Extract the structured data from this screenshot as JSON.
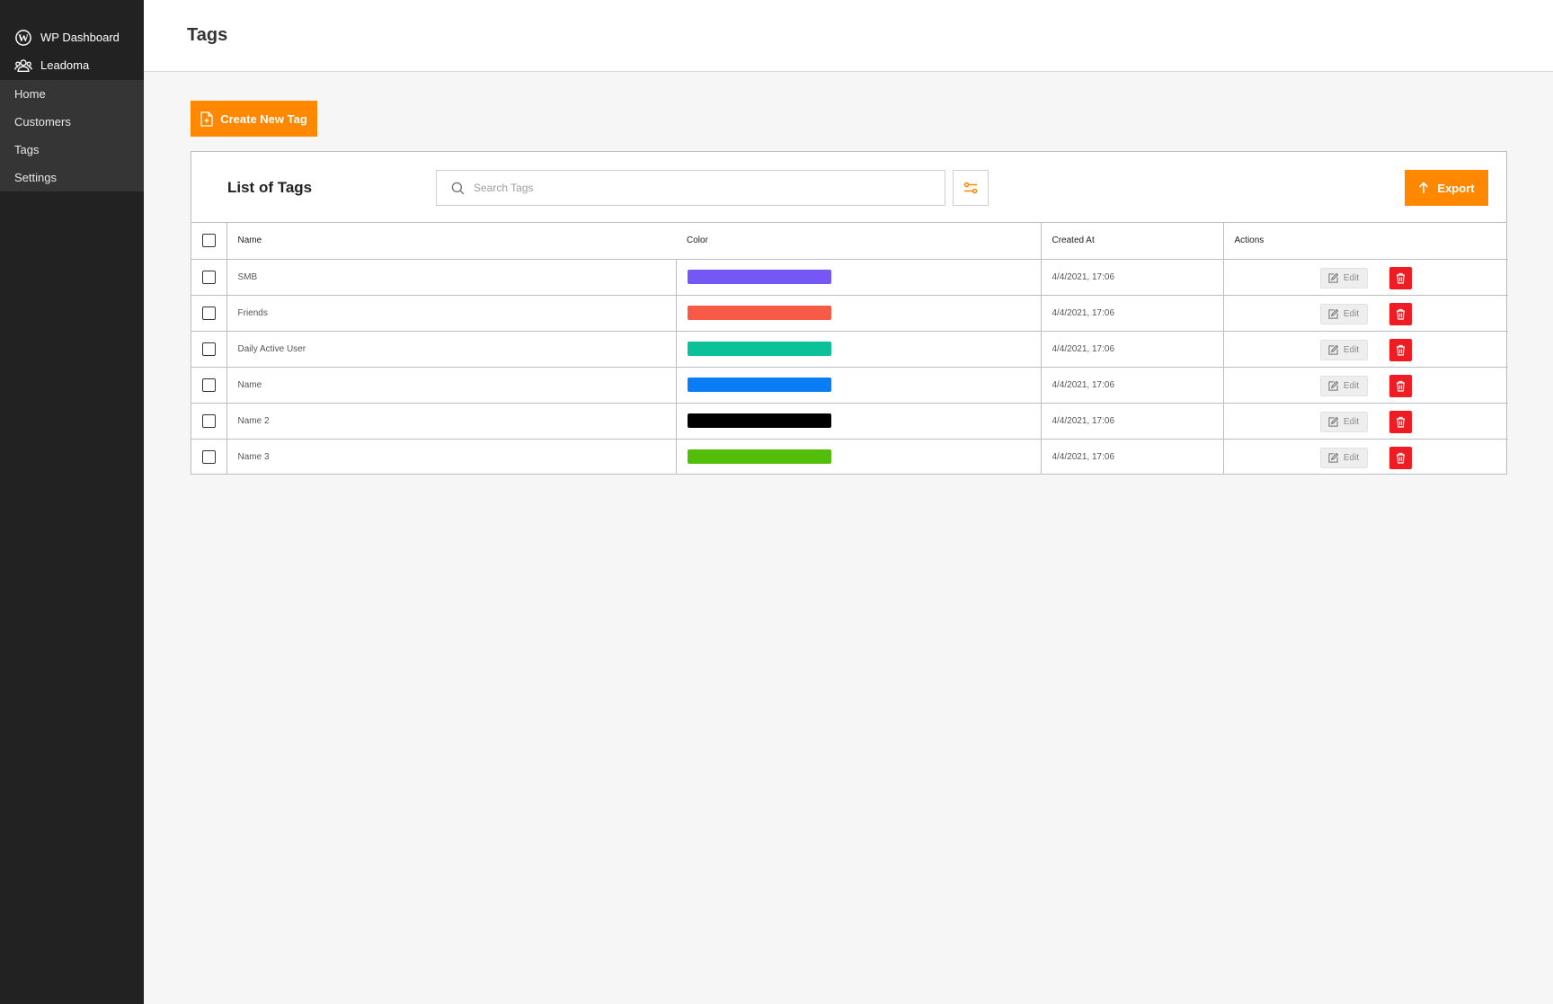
{
  "sidebar": {
    "brand_items": [
      {
        "label": "WP Dashboard",
        "icon": "wordpress-icon"
      },
      {
        "label": "Leadoma",
        "icon": "users-icon"
      }
    ],
    "nav_items": [
      {
        "label": "Home"
      },
      {
        "label": "Customers"
      },
      {
        "label": "Tags"
      },
      {
        "label": "Settings"
      }
    ]
  },
  "header": {
    "title": "Tags"
  },
  "toolbar": {
    "create_label": "Create New Tag"
  },
  "card": {
    "title": "List of Tags",
    "search_placeholder": "Search Tags",
    "export_label": "Export"
  },
  "table": {
    "columns": [
      "Name",
      "Color",
      "Created At",
      "Actions"
    ],
    "edit_label": "Edit",
    "rows": [
      {
        "name": "SMB",
        "color": "#7557f5",
        "created_at": "4/4/2021, 17:06"
      },
      {
        "name": "Friends",
        "color": "#f75b48",
        "created_at": "4/4/2021, 17:06"
      },
      {
        "name": "Daily Active User",
        "color": "#0ac19a",
        "created_at": "4/4/2021, 17:06"
      },
      {
        "name": "Name",
        "color": "#0a7df5",
        "created_at": "4/4/2021, 17:06"
      },
      {
        "name": "Name 2",
        "color": "#000000",
        "created_at": "4/4/2021, 17:06"
      },
      {
        "name": "Name 3",
        "color": "#52be0a",
        "created_at": "4/4/2021, 17:06"
      }
    ]
  },
  "colors": {
    "accent": "#ff8800",
    "danger": "#ee1d24",
    "sidebar_bg": "#222222",
    "nav_bg": "#353535"
  }
}
